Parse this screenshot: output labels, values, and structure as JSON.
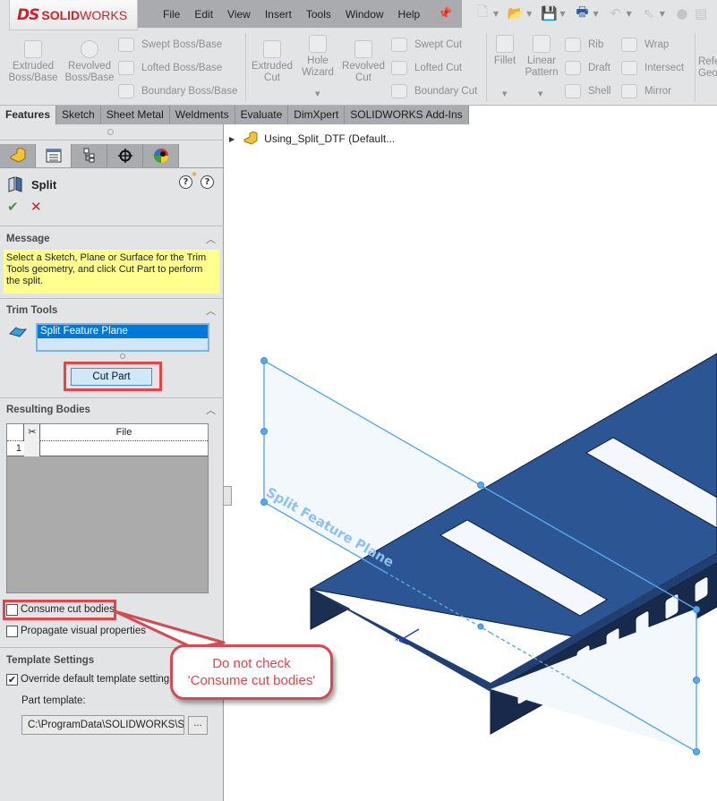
{
  "app": {
    "logo_prefix": "DS",
    "logo_bold": "SOLID",
    "logo_light": "WORKS",
    "brand_color": "#d0202b"
  },
  "menu": {
    "items": [
      "File",
      "Edit",
      "View",
      "Insert",
      "Tools",
      "Window",
      "Help"
    ],
    "pin_icon": "pin-icon"
  },
  "quick_access": {
    "icons": [
      "new-document-icon",
      "open-folder-icon",
      "save-icon",
      "print-icon",
      "undo-icon",
      "select-pointer-icon",
      "rebuild-icon",
      "options-icon"
    ]
  },
  "ribbon": {
    "extruded_boss": "Extruded\nBoss/Base",
    "revolved_boss": "Revolved\nBoss/Base",
    "swept_boss": "Swept Boss/Base",
    "lofted_boss": "Lofted Boss/Base",
    "boundary_boss": "Boundary Boss/Base",
    "extruded_cut": "Extruded\nCut",
    "hole_wizard": "Hole\nWizard",
    "revolved_cut": "Revolved\nCut",
    "swept_cut": "Swept Cut",
    "lofted_cut": "Lofted Cut",
    "boundary_cut": "Boundary Cut",
    "fillet": "Fillet",
    "linear_pattern": "Linear\nPattern",
    "rib": "Rib",
    "draft": "Draft",
    "shell": "Shell",
    "wrap": "Wrap",
    "intersect": "Intersect",
    "mirror": "Mirror",
    "ref_geometry": "Refe\nGeo"
  },
  "tabs": [
    "Features",
    "Sketch",
    "Sheet Metal",
    "Weldments",
    "Evaluate",
    "DimXpert",
    "SOLIDWORKS Add-Ins"
  ],
  "active_tab": "Features",
  "panel_tabs": [
    "feature-manager-icon",
    "property-manager-icon",
    "configuration-manager-icon",
    "dimxpert-manager-icon",
    "display-manager-icon"
  ],
  "property_manager": {
    "title": "Split",
    "ok_symbol": "✔",
    "cancel_symbol": "✕",
    "message": {
      "title": "Message",
      "text": "Select a Sketch, Plane or Surface for the Trim Tools geometry, and click Cut Part to perform the split."
    },
    "trim_tools": {
      "title": "Trim Tools",
      "selection": "Split Feature Plane",
      "cut_part_label": "Cut Part"
    },
    "resulting_bodies": {
      "title": "Resulting Bodies",
      "columns": [
        "",
        "✂",
        "File"
      ],
      "rows": [
        {
          "num": "1",
          "consume": "",
          "file": ""
        }
      ]
    },
    "options": {
      "consume_cut_bodies": {
        "label": "Consume cut bodies",
        "checked": false
      },
      "propagate_visual": {
        "label": "Propagate visual properties",
        "checked": false
      }
    },
    "template_settings": {
      "title": "Template Settings",
      "override_label": "Override default template settings",
      "override_checked": true,
      "part_template_label": "Part template:",
      "part_template_value": "C:\\ProgramData\\SOLIDWORKS\\SO",
      "browse_label": "..."
    }
  },
  "tree": {
    "part_name": "Using_Split_DTF  (Default..."
  },
  "viewport": {
    "plane_label": "Split Feature Plane",
    "part_color": "#2b5593",
    "plane_color": "#5aa8ea"
  },
  "callout": {
    "line1": "Do not check",
    "line2": "'Consume cut bodies'",
    "color": "#d84850"
  }
}
